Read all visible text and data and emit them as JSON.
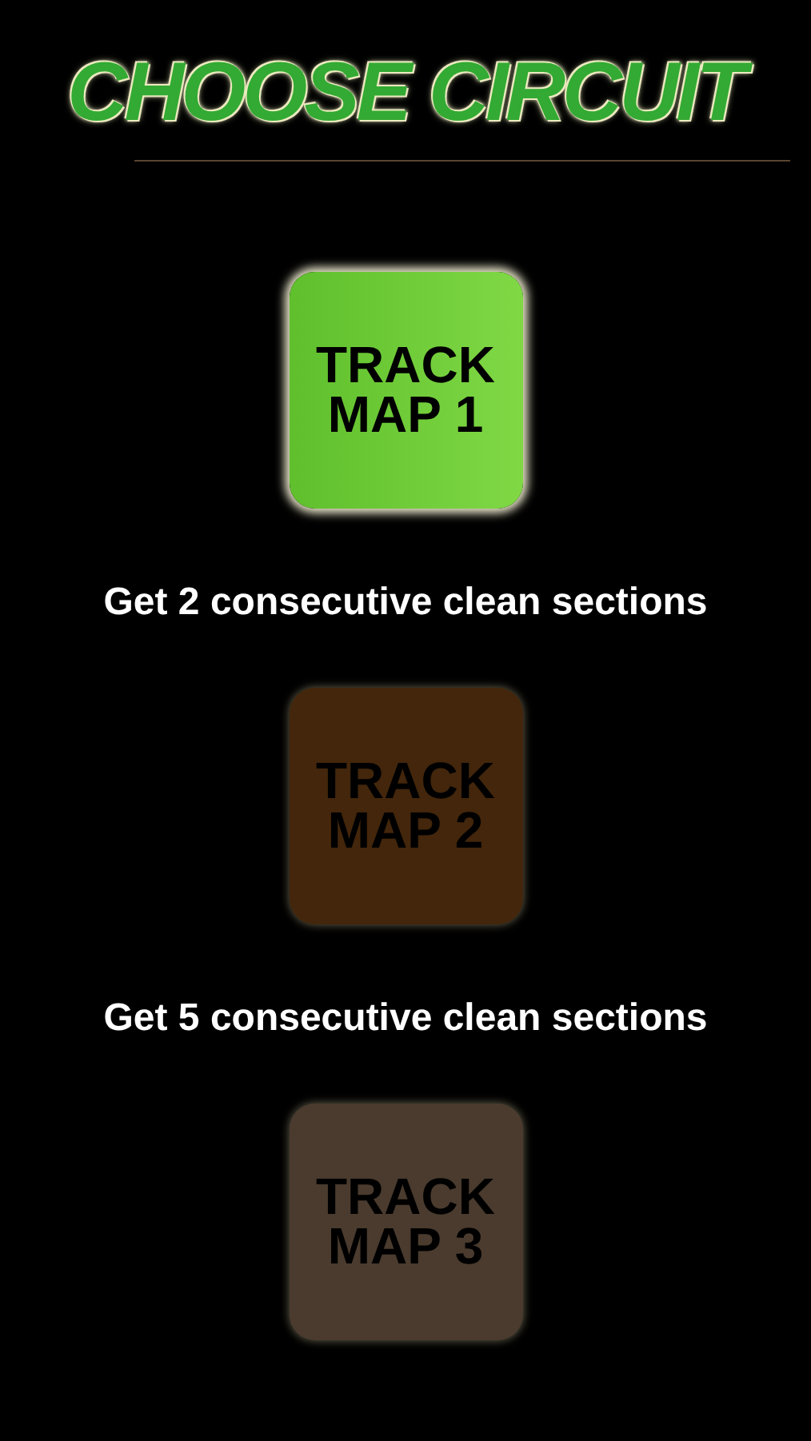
{
  "title": "CHOOSE CIRCUIT",
  "circuits": [
    {
      "label": "TRACK MAP 1",
      "color": "#5fbf2c",
      "locked": false,
      "requirement": "Get 2 consecutive clean sections"
    },
    {
      "label": "TRACK MAP 2",
      "color": "#43260b",
      "locked": true,
      "requirement": "Get 5 consecutive clean sections"
    },
    {
      "label": "TRACK MAP 3",
      "color": "#4a3b2e",
      "locked": true
    }
  ]
}
